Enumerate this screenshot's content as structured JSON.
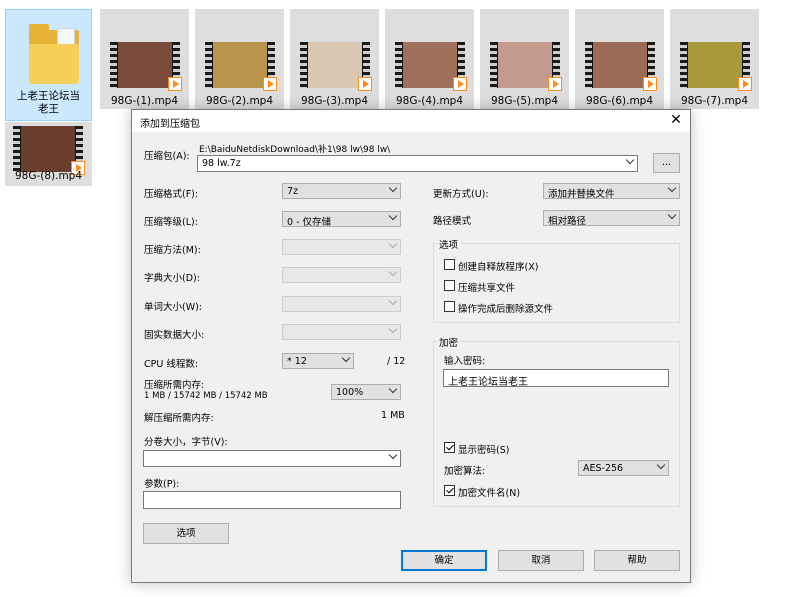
{
  "files": [
    {
      "name": "上老王论坛当老王",
      "type": "folder"
    },
    {
      "name": "98G-(1).mp4",
      "type": "video"
    },
    {
      "name": "98G-(2).mp4",
      "type": "video"
    },
    {
      "name": "98G-(3).mp4",
      "type": "video"
    },
    {
      "name": "98G-(4).mp4",
      "type": "video"
    },
    {
      "name": "98G-(5).mp4",
      "type": "video"
    },
    {
      "name": "98G-(6).mp4",
      "type": "video"
    },
    {
      "name": "98G-(7).mp4",
      "type": "video"
    },
    {
      "name": "98G-(8).mp4",
      "type": "video"
    }
  ],
  "dialog": {
    "title": "添加到压缩包",
    "close": "✕",
    "archive_label": "压缩包(A):",
    "archive_path": "E:\\BaiduNetdiskDownload\\补1\\98 lw\\98 lw\\",
    "archive_name": "98 lw.7z",
    "browse_label": "...",
    "left": {
      "format_label": "压缩格式(F):",
      "format_value": "7z",
      "level_label": "压缩等级(L):",
      "level_value": "0 - 仅存储",
      "method_label": "压缩方法(M):",
      "dict_label": "字典大小(D):",
      "word_label": "单词大小(W):",
      "solid_label": "固实数据大小:",
      "cpu_label": "CPU 线程数:",
      "cpu_value": "* 12",
      "cpu_total": "/ 12",
      "mem_label": "压缩所需内存:",
      "mem_detail": "1 MB / 15742 MB / 15742 MB",
      "mem_pct": "100%",
      "demem_label": "解压缩所需内存:",
      "demem_value": "1 MB",
      "split_label": "分卷大小，字节(V):",
      "params_label": "参数(P):",
      "options_button": "选项"
    },
    "right": {
      "update_label": "更新方式(U):",
      "update_value": "添加并替换文件",
      "path_label": "路径模式",
      "path_value": "相对路径",
      "options_group": "选项",
      "opt_sfx": "创建自释放程序(X)",
      "opt_shared": "压缩共享文件",
      "opt_delete": "操作完成后删除源文件",
      "encrypt_group": "加密",
      "password_label": "输入密码:",
      "password_value": "上老王论坛当老王",
      "show_password": "显示密码(S)",
      "method_label": "加密算法:",
      "method_value": "AES-256",
      "encrypt_names": "加密文件名(N)"
    },
    "ok": "确定",
    "cancel": "取消",
    "help": "帮助"
  }
}
